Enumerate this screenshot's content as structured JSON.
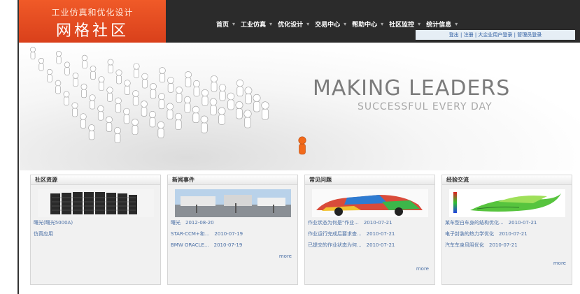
{
  "header": {
    "logo_subtitle": "工业仿真和优化设计",
    "logo_title": "网格社区",
    "nav": [
      "首页",
      "工业仿真",
      "优化设计",
      "交易中心",
      "帮助中心",
      "社区监控",
      "统计信息"
    ],
    "login_bar": "登出 | 注册 | 大企业用户登录 | 管理员登录"
  },
  "banner": {
    "title": "MAKING LEADERS",
    "subtitle": "SUCCESSFUL EVERY DAY"
  },
  "panels": [
    {
      "title": "社区资源",
      "items": [
        "曙光(曙光5000A)",
        "仿真应用"
      ],
      "more": ""
    },
    {
      "title": "新闻事件",
      "items": [
        "曙光　2012-08-20",
        "STAR-CCM+和...　2010-07-19",
        "BMW ORACLE...　2010-07-19"
      ],
      "more": "more"
    },
    {
      "title": "常见问题",
      "items": [
        "作业状态为何是\"作业...　2010-07-21",
        "作业运行完成后要求查...　2010-07-21",
        "已提交的作业状态为何...　2010-07-21"
      ],
      "more": "more"
    },
    {
      "title": "经验交流",
      "items": [
        "某车型白车身的结构优化...　2010-07-21",
        "电子封装的热力学优化　2010-07-21",
        "汽车车身风阻优化　2010-07-21"
      ],
      "more": "more"
    }
  ]
}
